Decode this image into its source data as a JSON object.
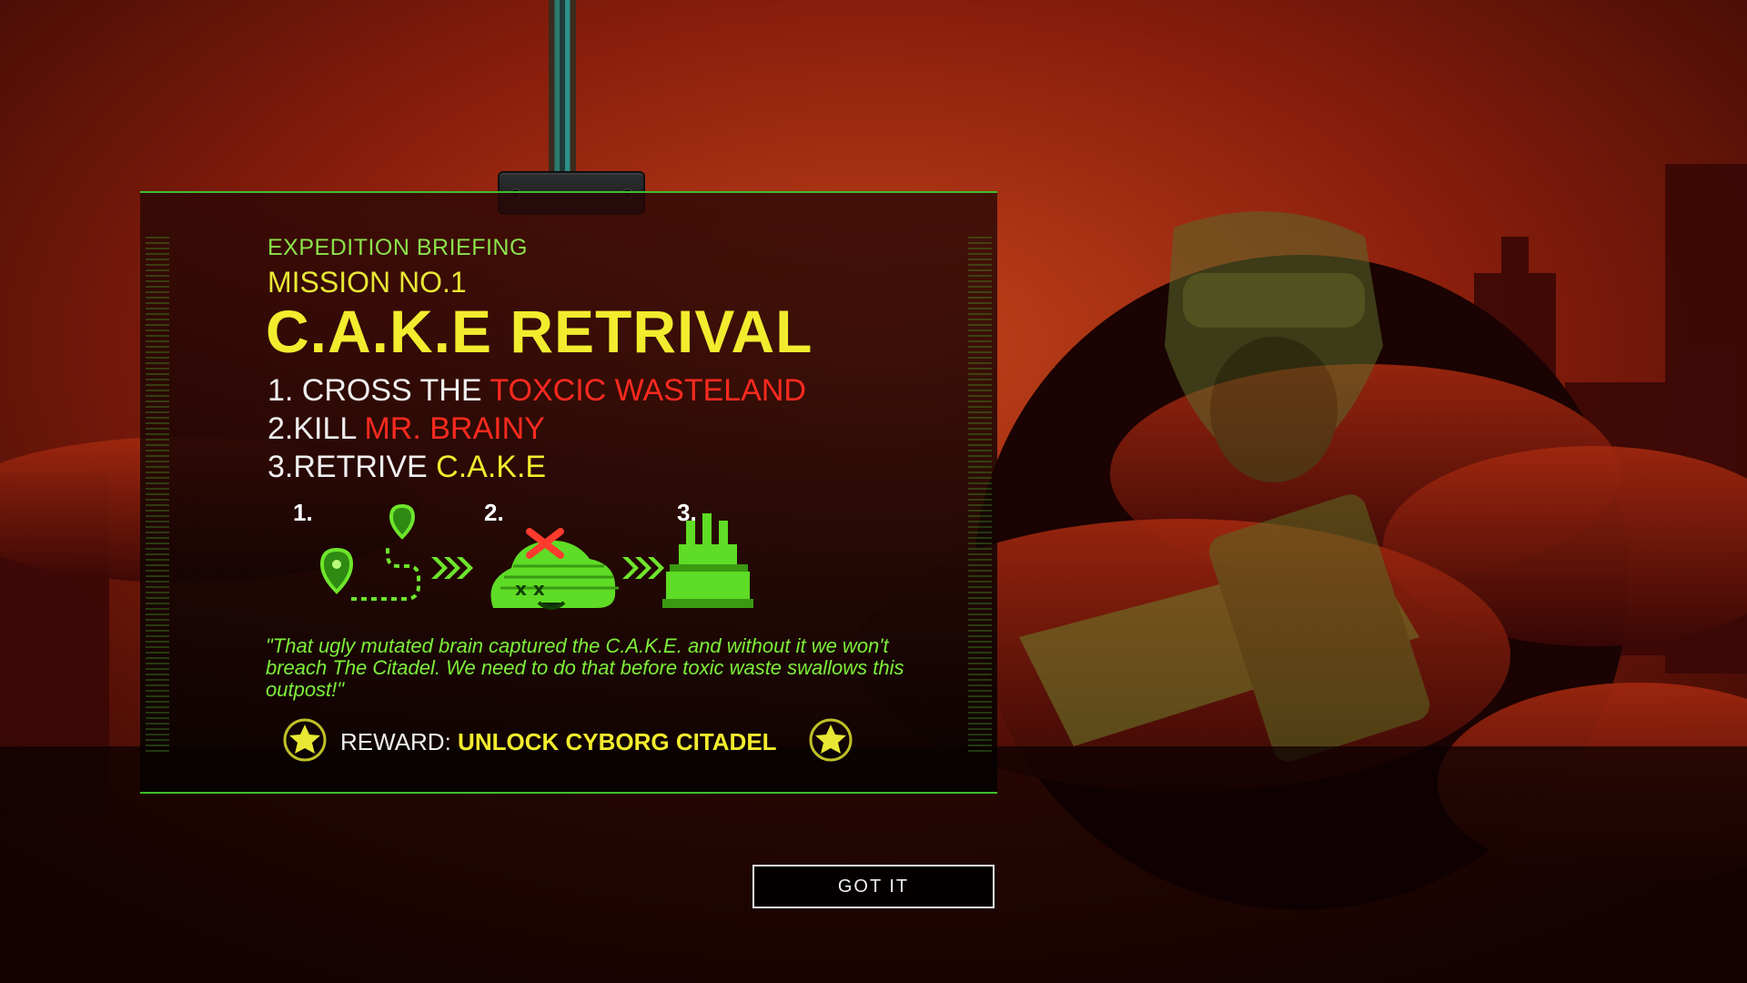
{
  "briefing": {
    "eyebrow": "EXPEDITION BRIEFING",
    "mission": "MISSION NO.1",
    "title": "C.A.K.E RETRIVAL",
    "steps": [
      {
        "prefix": "1. CROSS THE ",
        "highlight": "TOXCIC WASTELAND",
        "color": "#ff2a1f"
      },
      {
        "prefix": "2.KILL ",
        "highlight": "MR. BRAINY",
        "color": "#ff2a1f"
      },
      {
        "prefix": "3.RETRIVE ",
        "highlight": "C.A.K.E",
        "color": "#f2ec2e"
      }
    ],
    "diagram": {
      "labels": [
        "1.",
        "2.",
        "3."
      ],
      "icons": [
        "route-map-icon",
        "dead-brain-icon",
        "cake-icon"
      ]
    },
    "quote": "\"That ugly mutated brain captured the C.A.K.E. and without it we won't breach The Citadel. We need to do that before toxic waste swallows this outpost!\"",
    "reward_label": "REWARD:",
    "reward_value": "UNLOCK CYBORG CITADEL"
  },
  "actions": {
    "got_it": "GOT IT"
  },
  "colors": {
    "accent_green": "#3fbf2a",
    "title_yellow": "#f2ec2e",
    "danger_red": "#ff2a1f",
    "quote_green": "#7df03a"
  }
}
